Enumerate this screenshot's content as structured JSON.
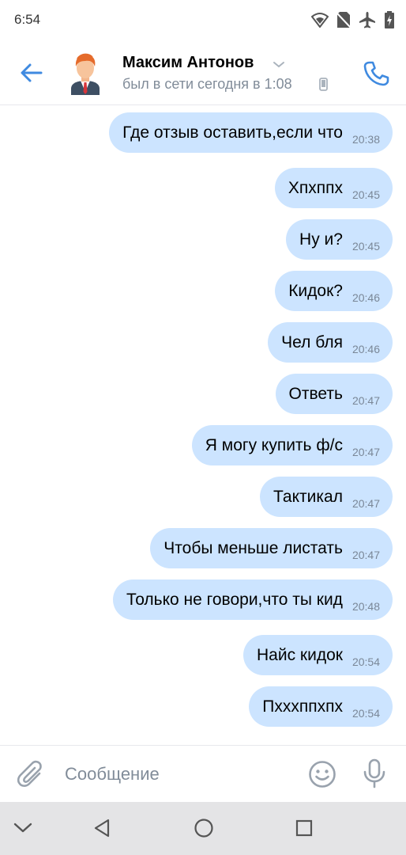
{
  "status_bar": {
    "time": "6:54",
    "icons": [
      "wifi-icon",
      "no-sim-icon",
      "airplane-icon",
      "battery-icon"
    ]
  },
  "header": {
    "contact_name": "Максим Антонов",
    "contact_status": "был в сети сегодня в 1:08",
    "icons": [
      "back-arrow-icon",
      "avatar",
      "chevron-down-icon",
      "mobile-phone-icon",
      "call-icon"
    ]
  },
  "messages": [
    {
      "text": "Где отзыв оставить,если что",
      "time": "20:38"
    },
    {
      "text": "Хпхппх",
      "time": "20:45"
    },
    {
      "text": "Ну и?",
      "time": "20:45"
    },
    {
      "text": "Кидок?",
      "time": "20:46"
    },
    {
      "text": "Чел бля",
      "time": "20:46"
    },
    {
      "text": "Ответь",
      "time": "20:47"
    },
    {
      "text": "Я могу купить ф/с",
      "time": "20:47"
    },
    {
      "text": "Тактикал",
      "time": "20:47"
    },
    {
      "text": "Чтобы меньше листать",
      "time": "20:47"
    },
    {
      "text": "Только не говори,что ты кид",
      "time": "20:48"
    },
    {
      "text": "Найс кидок",
      "time": "20:54"
    },
    {
      "text": "Пхххппхпх",
      "time": "20:54"
    }
  ],
  "composer": {
    "placeholder": "Сообщение",
    "value": ""
  },
  "colors": {
    "accent": "#3f8ae0",
    "bubble": "#cce4ff",
    "secondary_text": "#818c99",
    "nav_bar": "#e4e4e6"
  }
}
